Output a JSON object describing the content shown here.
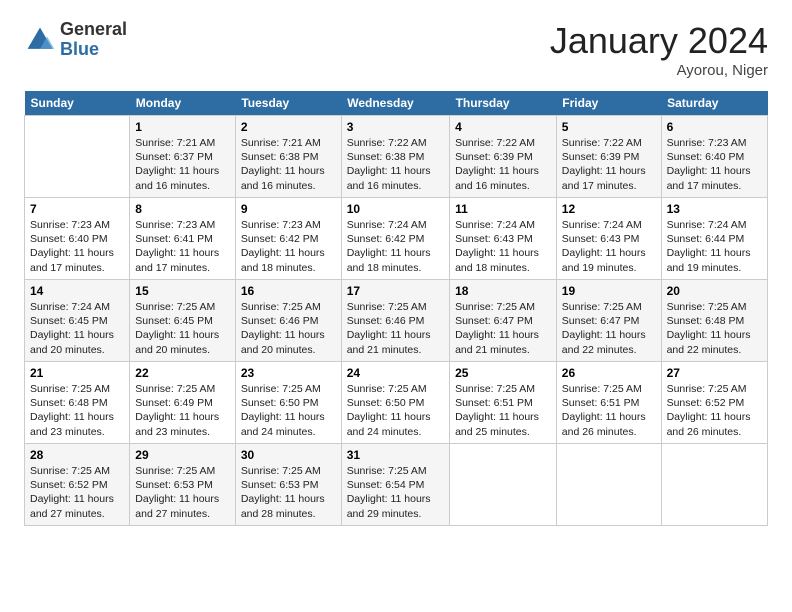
{
  "header": {
    "logo_general": "General",
    "logo_blue": "Blue",
    "month_title": "January 2024",
    "location": "Ayorou, Niger"
  },
  "days_of_week": [
    "Sunday",
    "Monday",
    "Tuesday",
    "Wednesday",
    "Thursday",
    "Friday",
    "Saturday"
  ],
  "weeks": [
    [
      {
        "num": "",
        "sunrise": "",
        "sunset": "",
        "daylight": ""
      },
      {
        "num": "1",
        "sunrise": "Sunrise: 7:21 AM",
        "sunset": "Sunset: 6:37 PM",
        "daylight": "Daylight: 11 hours and 16 minutes."
      },
      {
        "num": "2",
        "sunrise": "Sunrise: 7:21 AM",
        "sunset": "Sunset: 6:38 PM",
        "daylight": "Daylight: 11 hours and 16 minutes."
      },
      {
        "num": "3",
        "sunrise": "Sunrise: 7:22 AM",
        "sunset": "Sunset: 6:38 PM",
        "daylight": "Daylight: 11 hours and 16 minutes."
      },
      {
        "num": "4",
        "sunrise": "Sunrise: 7:22 AM",
        "sunset": "Sunset: 6:39 PM",
        "daylight": "Daylight: 11 hours and 16 minutes."
      },
      {
        "num": "5",
        "sunrise": "Sunrise: 7:22 AM",
        "sunset": "Sunset: 6:39 PM",
        "daylight": "Daylight: 11 hours and 17 minutes."
      },
      {
        "num": "6",
        "sunrise": "Sunrise: 7:23 AM",
        "sunset": "Sunset: 6:40 PM",
        "daylight": "Daylight: 11 hours and 17 minutes."
      }
    ],
    [
      {
        "num": "7",
        "sunrise": "Sunrise: 7:23 AM",
        "sunset": "Sunset: 6:40 PM",
        "daylight": "Daylight: 11 hours and 17 minutes."
      },
      {
        "num": "8",
        "sunrise": "Sunrise: 7:23 AM",
        "sunset": "Sunset: 6:41 PM",
        "daylight": "Daylight: 11 hours and 17 minutes."
      },
      {
        "num": "9",
        "sunrise": "Sunrise: 7:23 AM",
        "sunset": "Sunset: 6:42 PM",
        "daylight": "Daylight: 11 hours and 18 minutes."
      },
      {
        "num": "10",
        "sunrise": "Sunrise: 7:24 AM",
        "sunset": "Sunset: 6:42 PM",
        "daylight": "Daylight: 11 hours and 18 minutes."
      },
      {
        "num": "11",
        "sunrise": "Sunrise: 7:24 AM",
        "sunset": "Sunset: 6:43 PM",
        "daylight": "Daylight: 11 hours and 18 minutes."
      },
      {
        "num": "12",
        "sunrise": "Sunrise: 7:24 AM",
        "sunset": "Sunset: 6:43 PM",
        "daylight": "Daylight: 11 hours and 19 minutes."
      },
      {
        "num": "13",
        "sunrise": "Sunrise: 7:24 AM",
        "sunset": "Sunset: 6:44 PM",
        "daylight": "Daylight: 11 hours and 19 minutes."
      }
    ],
    [
      {
        "num": "14",
        "sunrise": "Sunrise: 7:24 AM",
        "sunset": "Sunset: 6:45 PM",
        "daylight": "Daylight: 11 hours and 20 minutes."
      },
      {
        "num": "15",
        "sunrise": "Sunrise: 7:25 AM",
        "sunset": "Sunset: 6:45 PM",
        "daylight": "Daylight: 11 hours and 20 minutes."
      },
      {
        "num": "16",
        "sunrise": "Sunrise: 7:25 AM",
        "sunset": "Sunset: 6:46 PM",
        "daylight": "Daylight: 11 hours and 20 minutes."
      },
      {
        "num": "17",
        "sunrise": "Sunrise: 7:25 AM",
        "sunset": "Sunset: 6:46 PM",
        "daylight": "Daylight: 11 hours and 21 minutes."
      },
      {
        "num": "18",
        "sunrise": "Sunrise: 7:25 AM",
        "sunset": "Sunset: 6:47 PM",
        "daylight": "Daylight: 11 hours and 21 minutes."
      },
      {
        "num": "19",
        "sunrise": "Sunrise: 7:25 AM",
        "sunset": "Sunset: 6:47 PM",
        "daylight": "Daylight: 11 hours and 22 minutes."
      },
      {
        "num": "20",
        "sunrise": "Sunrise: 7:25 AM",
        "sunset": "Sunset: 6:48 PM",
        "daylight": "Daylight: 11 hours and 22 minutes."
      }
    ],
    [
      {
        "num": "21",
        "sunrise": "Sunrise: 7:25 AM",
        "sunset": "Sunset: 6:48 PM",
        "daylight": "Daylight: 11 hours and 23 minutes."
      },
      {
        "num": "22",
        "sunrise": "Sunrise: 7:25 AM",
        "sunset": "Sunset: 6:49 PM",
        "daylight": "Daylight: 11 hours and 23 minutes."
      },
      {
        "num": "23",
        "sunrise": "Sunrise: 7:25 AM",
        "sunset": "Sunset: 6:50 PM",
        "daylight": "Daylight: 11 hours and 24 minutes."
      },
      {
        "num": "24",
        "sunrise": "Sunrise: 7:25 AM",
        "sunset": "Sunset: 6:50 PM",
        "daylight": "Daylight: 11 hours and 24 minutes."
      },
      {
        "num": "25",
        "sunrise": "Sunrise: 7:25 AM",
        "sunset": "Sunset: 6:51 PM",
        "daylight": "Daylight: 11 hours and 25 minutes."
      },
      {
        "num": "26",
        "sunrise": "Sunrise: 7:25 AM",
        "sunset": "Sunset: 6:51 PM",
        "daylight": "Daylight: 11 hours and 26 minutes."
      },
      {
        "num": "27",
        "sunrise": "Sunrise: 7:25 AM",
        "sunset": "Sunset: 6:52 PM",
        "daylight": "Daylight: 11 hours and 26 minutes."
      }
    ],
    [
      {
        "num": "28",
        "sunrise": "Sunrise: 7:25 AM",
        "sunset": "Sunset: 6:52 PM",
        "daylight": "Daylight: 11 hours and 27 minutes."
      },
      {
        "num": "29",
        "sunrise": "Sunrise: 7:25 AM",
        "sunset": "Sunset: 6:53 PM",
        "daylight": "Daylight: 11 hours and 27 minutes."
      },
      {
        "num": "30",
        "sunrise": "Sunrise: 7:25 AM",
        "sunset": "Sunset: 6:53 PM",
        "daylight": "Daylight: 11 hours and 28 minutes."
      },
      {
        "num": "31",
        "sunrise": "Sunrise: 7:25 AM",
        "sunset": "Sunset: 6:54 PM",
        "daylight": "Daylight: 11 hours and 29 minutes."
      },
      {
        "num": "",
        "sunrise": "",
        "sunset": "",
        "daylight": ""
      },
      {
        "num": "",
        "sunrise": "",
        "sunset": "",
        "daylight": ""
      },
      {
        "num": "",
        "sunrise": "",
        "sunset": "",
        "daylight": ""
      }
    ]
  ]
}
